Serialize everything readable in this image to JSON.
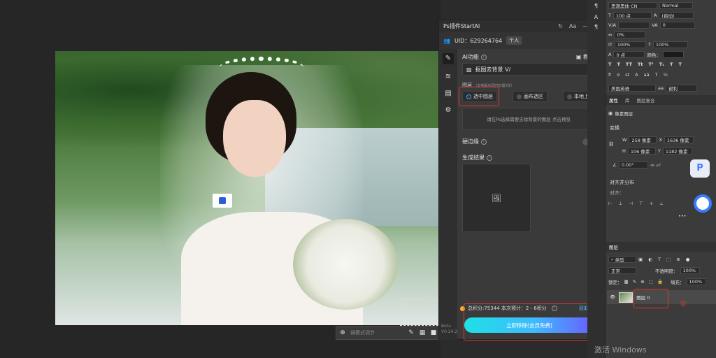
{
  "plugin": {
    "title": "Ps插件StartAI",
    "title_controls": [
      "↻",
      "Aa",
      "—",
      "✕"
    ],
    "uid": "UID：629264764",
    "account_badge": "个人",
    "ai_function_label": "AI功能",
    "tutorial_label": "教程",
    "mode_value": "抠图去背景 V/",
    "image_label": "图层",
    "image_note": "（支持最多同时处理5张）",
    "source_options": [
      "选中图层",
      "画布选区",
      "本地上传"
    ],
    "hint": "请在Ps选择需要去除背景的图层 点击预览",
    "hard_edge_label": "硬边缘",
    "result_label": "生成结果",
    "points_text": "总积分:75344  本次预计：2 - 6积分",
    "earn_label": "获取积分",
    "action_button": "立即移除(会员免费)",
    "version": "Beta\nV0.24.2"
  },
  "canvas": {
    "bottom_tool_text": "弱模式调节"
  },
  "ps_panel": {
    "font_family": "思源黑体 CN",
    "font_style": "Normal",
    "size": "100 点",
    "leading": "(自动)",
    "tracking": "0",
    "kerning": "0%",
    "vscale": "100%",
    "hscale": "100%",
    "baseline": "0 点",
    "color_label": "颜色：",
    "language": "美国英语",
    "aa": "锐利",
    "tabs_props": [
      "属性",
      "库",
      "图层复合"
    ],
    "pixel_layer": "像素图层",
    "transform_title": "变换",
    "w": "258 像素",
    "x": "1636 像素",
    "h": "106 像素",
    "y": "1182 像素",
    "angle": "0.00°",
    "align_title": "对齐并分布",
    "align_label": "对齐：",
    "layers_tab": "图层",
    "filter_type": "类型",
    "blend_mode": "正常",
    "opacity_label": "不透明度：",
    "opacity": "100%",
    "lock_label": "锁定：",
    "fill_label": "填充：",
    "fill": "100%",
    "layer_name": "图层 0",
    "step_marker": "①"
  },
  "watermark": "激活 Windows",
  "colors": {
    "accent_blue": "#3aa0ff",
    "highlight_red": "#e0382b",
    "button_gradient_start": "#1fe0e6",
    "button_gradient_end": "#6a5cff"
  }
}
